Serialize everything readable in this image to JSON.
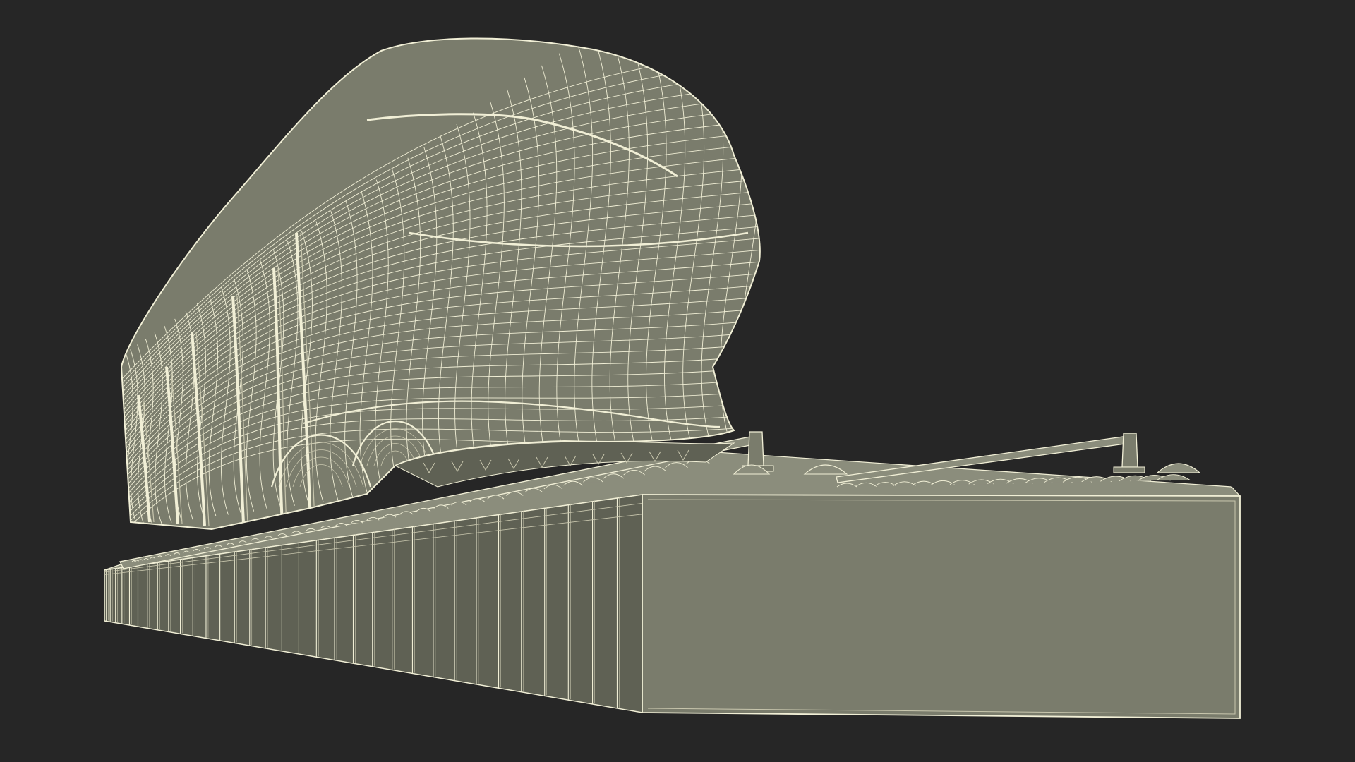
{
  "scene": {
    "subject": "wireframe-train-on-track",
    "colors": {
      "background": "#262626",
      "surface": "#7a7c6c",
      "surface_dark": "#5f6154",
      "surface_light": "#8b8d7c",
      "wire": "#f1efd6",
      "wire_dim": "#c9c7ae"
    }
  }
}
